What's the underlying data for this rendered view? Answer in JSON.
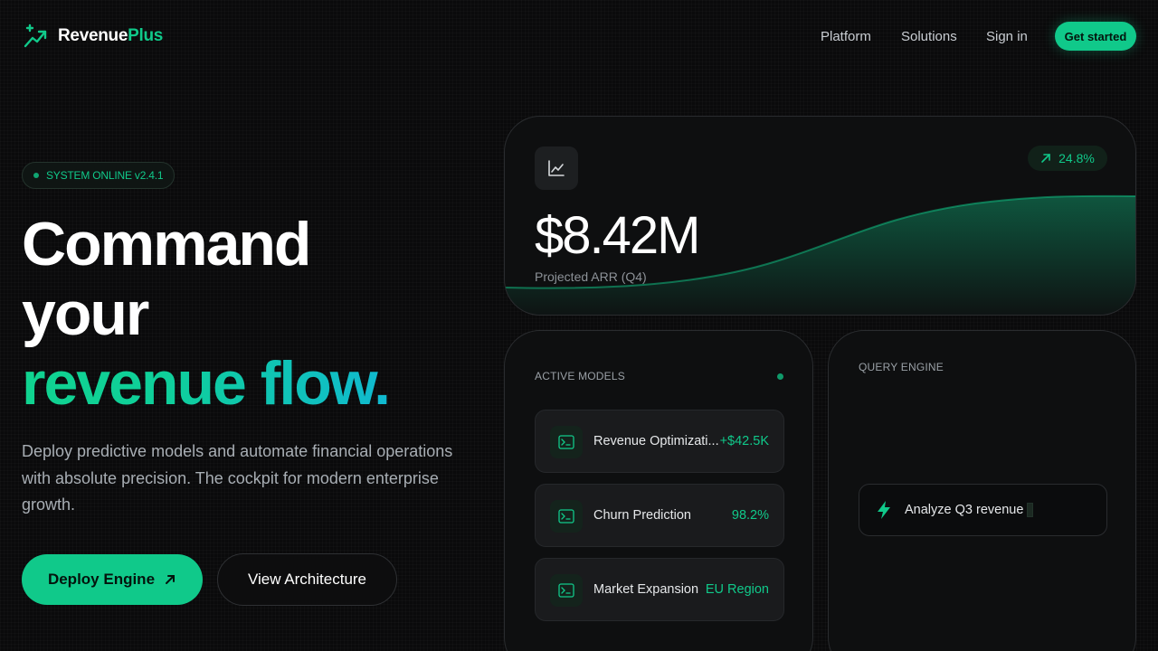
{
  "brand": {
    "name_a": "Revenue",
    "name_b": "Plus",
    "logo_icon": "trend-up-sparkle-icon",
    "color": "#10c98a"
  },
  "nav": {
    "links": [
      "Platform",
      "Solutions",
      "Sign in"
    ],
    "cta": "Get started"
  },
  "hero": {
    "badge": "SYSTEM ONLINE v2.4.1",
    "headline_line1": "Command",
    "headline_line2": "your",
    "headline_line3": "revenue flow.",
    "subtitle": "Deploy predictive models and automate financial operations with absolute precision. The cockpit for modern enterprise growth.",
    "primary_button": "Deploy Engine",
    "secondary_button": "View Architecture"
  },
  "arr_card": {
    "icon": "line-chart-icon",
    "trend": "24.8%",
    "value": "$8.42M",
    "label": "Projected ARR (Q4)"
  },
  "models_card": {
    "label": "ACTIVE MODELS",
    "items": [
      {
        "name": "Revenue Optimizati...",
        "metric": "+$42.5K",
        "icon": "terminal-icon"
      },
      {
        "name": "Churn Prediction",
        "metric": "98.2%",
        "icon": "terminal-icon"
      },
      {
        "name": "Market Expansion",
        "metric": "EU Region",
        "icon": "terminal-icon"
      }
    ]
  },
  "query_card": {
    "label": "QUERY ENGINE",
    "input_value": "Analyze Q3 revenue",
    "icon": "lightning-icon"
  }
}
